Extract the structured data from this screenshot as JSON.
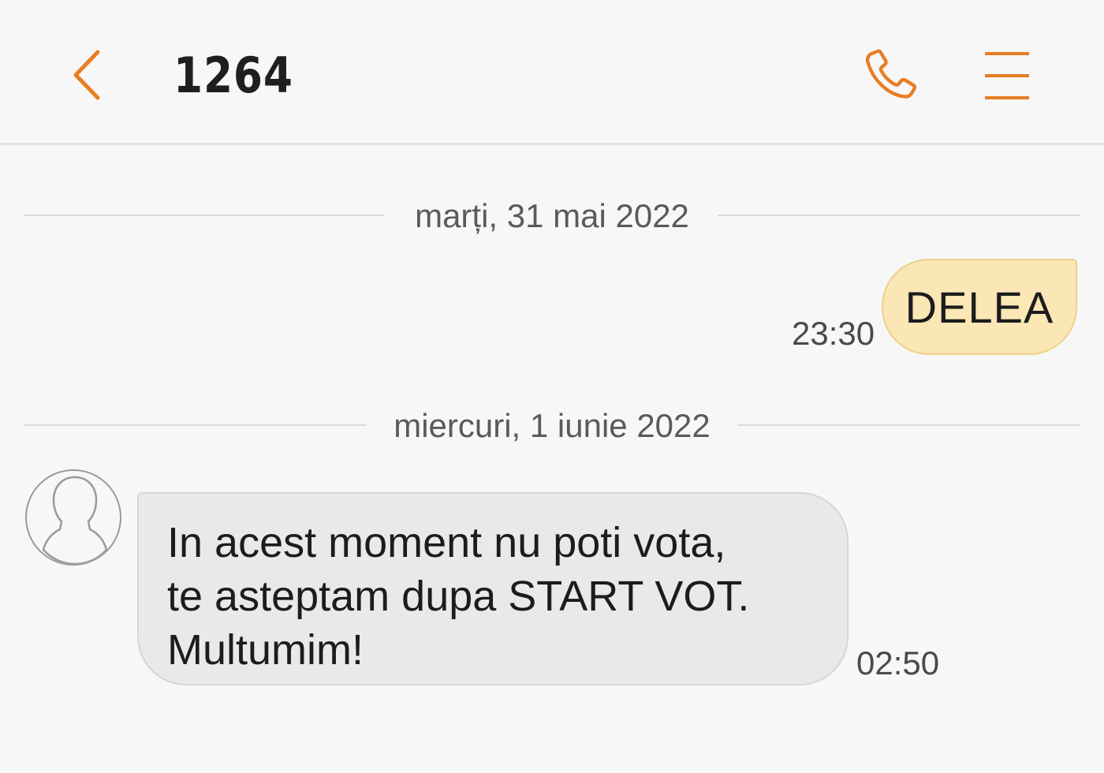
{
  "header": {
    "title": "1264",
    "accent_color": "#e87d22",
    "icons": {
      "back": "chevron-left-icon",
      "call": "phone-icon",
      "menu": "menu-icon"
    }
  },
  "conversation": {
    "date_separators": [
      "marți, 31 mai 2022",
      "miercuri, 1 iunie 2022"
    ],
    "messages": [
      {
        "direction": "sent",
        "text": "DELEA",
        "time": "23:30"
      },
      {
        "direction": "received",
        "text": "In acest moment nu poti vota,\nte asteptam dupa START VOT.\nMultumim!",
        "time": "02:50"
      }
    ]
  },
  "colors": {
    "sent_bubble": "#fbe6b5",
    "received_bubble": "#e9e9e9",
    "background": "#f7f7f7"
  }
}
